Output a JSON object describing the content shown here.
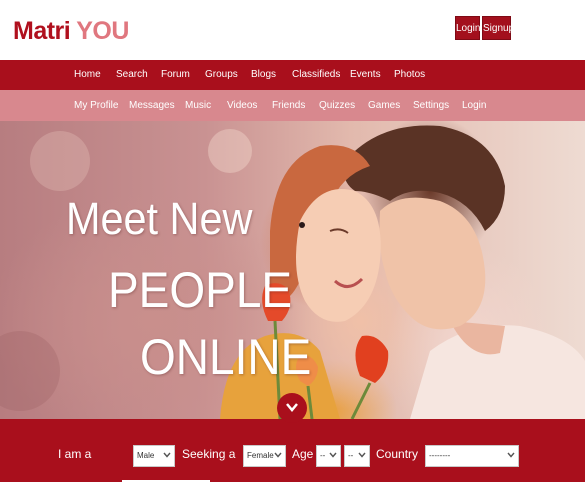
{
  "header": {
    "logo_part1": "Matri",
    "logo_part2": "YOU",
    "login_label": "Login",
    "signup_label": "Signup"
  },
  "nav_primary": [
    {
      "label": "Home"
    },
    {
      "label": "Search"
    },
    {
      "label": "Forum"
    },
    {
      "label": "Groups"
    },
    {
      "label": "Blogs"
    },
    {
      "label": "Classifieds"
    },
    {
      "label": "Events"
    },
    {
      "label": "Photos"
    }
  ],
  "nav_secondary": [
    {
      "label": "My Profile"
    },
    {
      "label": "Messages"
    },
    {
      "label": "Music"
    },
    {
      "label": "Videos"
    },
    {
      "label": "Friends"
    },
    {
      "label": "Quizzes"
    },
    {
      "label": "Games"
    },
    {
      "label": "Settings"
    },
    {
      "label": "Login"
    }
  ],
  "hero": {
    "line1": "Meet New",
    "line2": "PEOPLE",
    "line3": "ONLINE",
    "scroll_icon": "chevron-down-icon"
  },
  "search": {
    "i_am_label": "I am a",
    "gender_value": "Male",
    "seeking_label": "Seeking a",
    "seeking_value": "Female",
    "age_label": "Age",
    "age_from_value": "--",
    "age_to_value": "--",
    "country_label": "Country",
    "country_value": "--------"
  },
  "colors": {
    "brand_red": "#a90f1c",
    "brand_pink": "#d8888e",
    "logo_red": "#b0101e",
    "logo_pink": "#e0777f"
  }
}
